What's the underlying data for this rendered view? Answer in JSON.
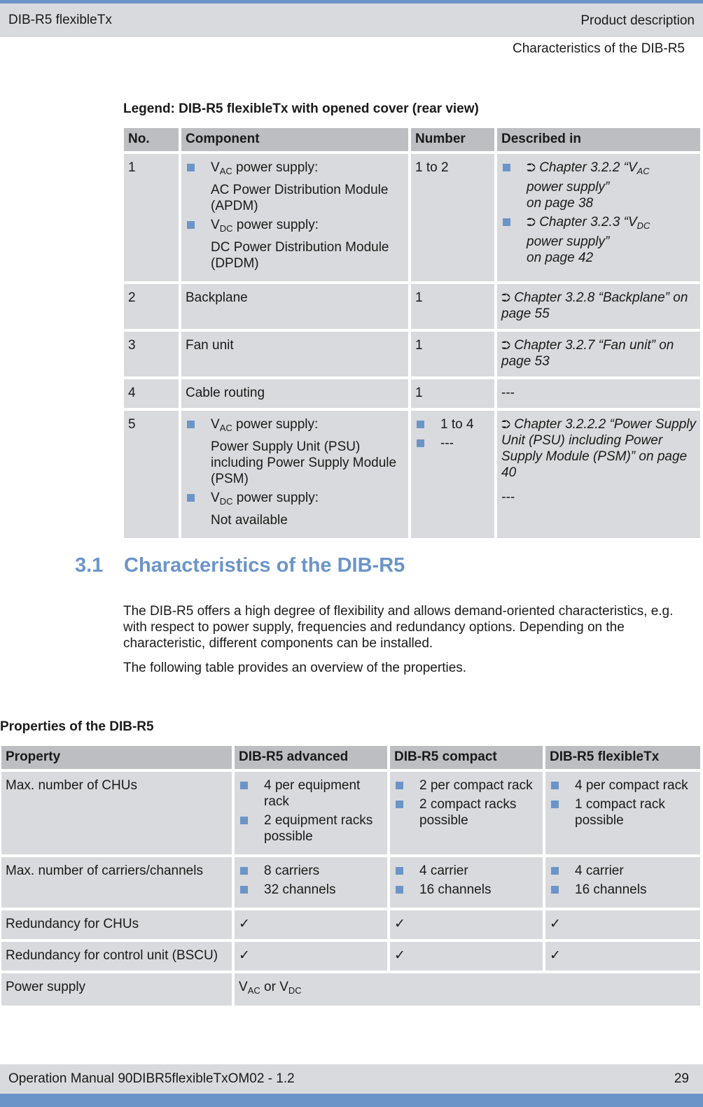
{
  "header": {
    "left": "DIB-R5 flexibleTx",
    "right": "Product description",
    "sub": "Characteristics of the DIB-R5"
  },
  "legend_table": {
    "caption": "Legend: DIB-R5 flexibleTx with opened cover (rear view)",
    "columns": [
      "No.",
      "Component",
      "Number",
      "Described in"
    ],
    "rows": [
      {
        "no": "1",
        "component": [
          {
            "sym": "V",
            "sub": "AC",
            "text": " power supply:",
            "detail": "AC Power Distribution Module (APDM)"
          },
          {
            "sym": "V",
            "sub": "DC",
            "text": " power supply:",
            "detail": "DC Power Distribution Module (DPDM)"
          }
        ],
        "number": "1 to 2",
        "described": [
          {
            "pre": "Chapter 3.2.2 “V",
            "sub": "AC",
            "post": " power supply”",
            "page": "on page 38"
          },
          {
            "pre": "Chapter 3.2.3 “V",
            "sub": "DC",
            "post": " power supply”",
            "page": "on page 42"
          }
        ]
      },
      {
        "no": "2",
        "component": "Backplane",
        "number": "1",
        "described": "Chapter 3.2.8 “Backplane” on page 55"
      },
      {
        "no": "3",
        "component": "Fan unit",
        "number": "1",
        "described": "Chapter 3.2.7 “Fan unit” on page 53"
      },
      {
        "no": "4",
        "component": "Cable routing",
        "number": "1",
        "described": "---"
      },
      {
        "no": "5",
        "component": [
          {
            "sym": "V",
            "sub": "AC",
            "text": " power supply:",
            "detail": "Power Supply Unit (PSU) including Power Supply Module (PSM)"
          },
          {
            "sym": "V",
            "sub": "DC",
            "text": " power supply:",
            "detail": "Not available"
          }
        ],
        "number": [
          "1 to 4",
          "---"
        ],
        "described": [
          "Chapter 3.2.2.2 “Power Supply Unit (PSU) including Power Supply Module (PSM)” on page 40",
          "---"
        ]
      }
    ],
    "link_icon": "⮊"
  },
  "section": {
    "number": "3.1",
    "title": "Characteristics of the DIB-R5",
    "paragraphs": [
      "The DIB-R5 offers a high degree of flexibility and allows demand-oriented characteristics, e.g. with respect to power supply, frequencies and redundancy options. Depending on the characteristic, different components can be installed.",
      "The following table provides an overview of the properties."
    ]
  },
  "properties_table": {
    "caption": "Properties of the DIB-R5",
    "columns": [
      "Property",
      "DIB-R5 advanced",
      "DIB-R5 compact",
      "DIB-R5 flexibleTx"
    ],
    "rows": [
      {
        "property": "Max. number of CHUs",
        "values": [
          [
            "4 per equipment rack",
            "2 equipment racks possible"
          ],
          [
            "2 per compact rack",
            "2 compact racks possible"
          ],
          [
            "4 per compact rack",
            "1 compact rack possible"
          ]
        ]
      },
      {
        "property": "Max. number of carriers/channels",
        "values": [
          [
            "8 carriers",
            "32 channels"
          ],
          [
            "4 carrier",
            "16 channels"
          ],
          [
            "4 carrier",
            "16 channels"
          ]
        ]
      },
      {
        "property": "Redundancy for CHUs",
        "values": [
          "✓",
          "✓",
          "✓"
        ]
      },
      {
        "property": "Redundancy for control unit (BSCU)",
        "values": [
          "✓",
          "✓",
          "✓"
        ]
      },
      {
        "property": "Power supply",
        "merged": {
          "a": "V",
          "a_sub": "AC",
          "mid": " or ",
          "b": "V",
          "b_sub": "DC"
        }
      }
    ]
  },
  "footer": {
    "left": "Operation Manual 90DIBR5flexibleTxOM02 - 1.2",
    "page": "29"
  }
}
